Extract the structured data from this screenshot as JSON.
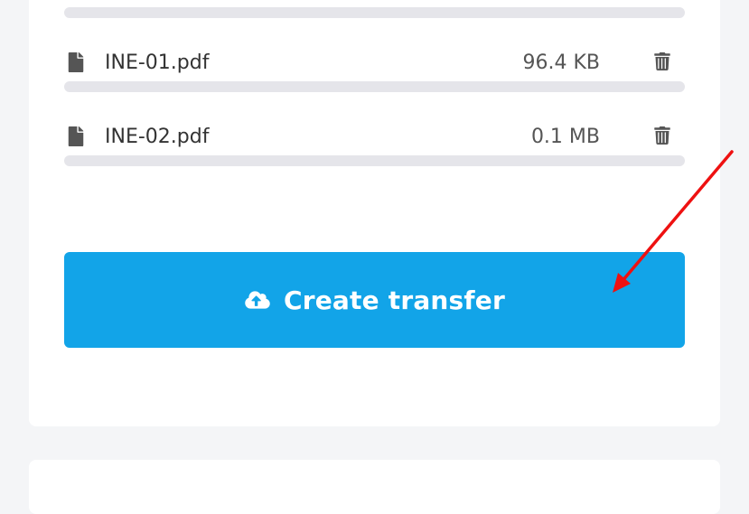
{
  "files": [
    {
      "name": "INE-01.pdf",
      "size": "96.4 KB",
      "progress": 0
    },
    {
      "name": "INE-02.pdf",
      "size": "0.1 MB",
      "progress": 0
    }
  ],
  "cta": {
    "label": "Create transfer",
    "icon": "cloud-upload-icon"
  },
  "colors": {
    "accent": "#12a4e8",
    "annotation_arrow": "#ee1111"
  }
}
